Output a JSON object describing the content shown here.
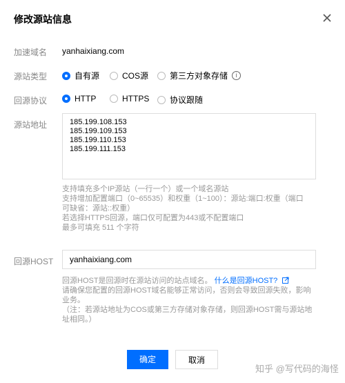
{
  "dialog": {
    "title": "修改源站信息"
  },
  "form": {
    "domain": {
      "label": "加速域名",
      "value": "yanhaixiang.com"
    },
    "origin_type": {
      "label": "源站类型",
      "options": [
        "自有源",
        "COS源",
        "第三方对象存储"
      ],
      "selected": "自有源",
      "info_glyph": "i"
    },
    "protocol": {
      "label": "回源协议",
      "options": [
        "HTTP",
        "HTTPS",
        "协议跟随"
      ],
      "selected": "HTTP"
    },
    "origin_address": {
      "label": "源站地址",
      "lines": [
        "185.199.108.153",
        "185.199.109.153",
        "185.199.110.153",
        "185.199.111.153"
      ],
      "help": [
        "支持填充多个IP源站（一行一个）或一个域名源站",
        "支持增加配置端口（0~65535）和权重（1~100）：源站:端口:权重（端口",
        "可缺省：源站::权重）",
        "若选择HTTPS回源，端口仅可配置为443或不配置端口",
        "最多可填充 511 个字符"
      ]
    },
    "host": {
      "label": "回源HOST",
      "value": "yanhaixiang.com",
      "help_prefix": "回源HOST是回源时在源站访问的站点域名。",
      "help_link": "什么是回源HOST?",
      "help_lines": [
        "请确保您配置的回源HOST域名能够正常访问，否则会导致回源失败，影响",
        "业务。",
        "（注：若源站地址为COS或第三方存储对象存储，则回源HOST需与源站地",
        "址相同。）"
      ]
    }
  },
  "buttons": {
    "confirm": "确定",
    "cancel": "取消"
  },
  "watermark": "知乎 @写代码的海怪",
  "colors": {
    "accent": "#006eff"
  }
}
